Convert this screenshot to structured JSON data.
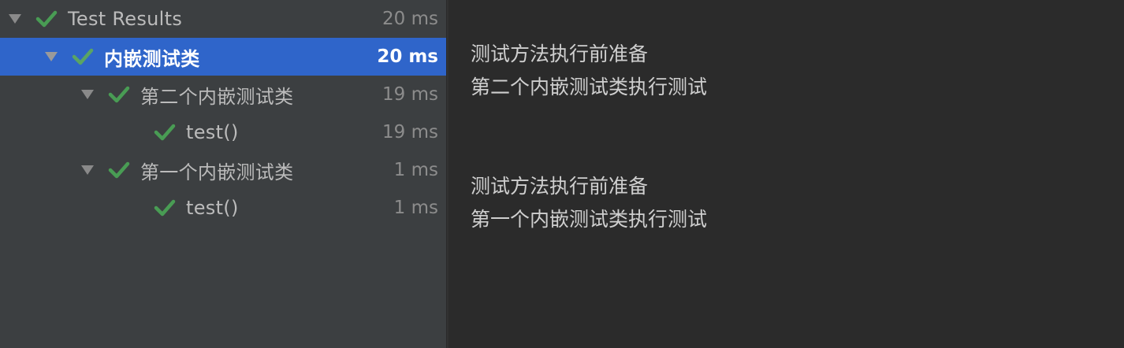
{
  "tree": {
    "items": [
      {
        "label": "Test Results",
        "duration": "20 ms",
        "status": "passed"
      },
      {
        "label": "内嵌测试类",
        "duration": "20 ms",
        "status": "passed",
        "selected": true
      },
      {
        "label": "第二个内嵌测试类",
        "duration": "19 ms",
        "status": "passed"
      },
      {
        "label": "test()",
        "duration": "19 ms",
        "status": "passed"
      },
      {
        "label": "第一个内嵌测试类",
        "duration": "1 ms",
        "status": "passed"
      },
      {
        "label": "test()",
        "duration": "1 ms",
        "status": "passed"
      }
    ]
  },
  "console": {
    "lines": [
      "测试方法执行前准备",
      "第二个内嵌测试类执行测试",
      "测试方法执行前准备",
      "第一个内嵌测试类执行测试"
    ]
  },
  "colors": {
    "tree_background": "#3c3f41",
    "console_background": "#2b2b2b",
    "selection": "#2f65ca",
    "pass_check": "#499c54",
    "text": "#bbbbbb",
    "duration": "#8c8c8c"
  },
  "icons": {
    "expand": "triangle-down-icon",
    "passed": "check-icon"
  }
}
